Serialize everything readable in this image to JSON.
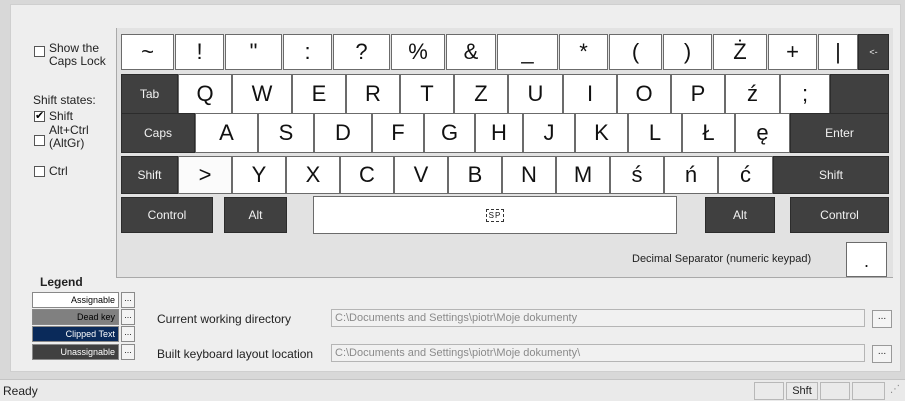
{
  "options": {
    "caps_lock_label": "Show the Caps Lock",
    "caps_lock_checked": false,
    "shift_states_title": "Shift states:",
    "shift_label": "Shift",
    "shift_checked": true,
    "altgr_label": "Alt+Ctrl (AltGr)",
    "altgr_checked": false,
    "ctrl_label": "Ctrl",
    "ctrl_checked": false
  },
  "keyboard": {
    "row1": [
      "~",
      "!",
      "\"",
      ":",
      "?",
      "%",
      "&",
      "_",
      "*",
      "(",
      ")",
      "Ż",
      "+",
      "|"
    ],
    "backspace": "<-",
    "tab": "Tab",
    "row2": [
      "Q",
      "W",
      "E",
      "R",
      "T",
      "Z",
      "U",
      "I",
      "O",
      "P",
      "ź",
      ";"
    ],
    "caps": "Caps",
    "row3": [
      "A",
      "S",
      "D",
      "F",
      "G",
      "H",
      "J",
      "K",
      "L",
      "Ł",
      "ę"
    ],
    "enter": "Enter",
    "lshift": "Shift",
    "row4": [
      ">",
      "Y",
      "X",
      "C",
      "V",
      "B",
      "N",
      "M",
      "ś",
      "ń",
      "ć"
    ],
    "rshift": "Shift",
    "lcontrol": "Control",
    "lalt": "Alt",
    "space": "SP",
    "ralt": "Alt",
    "rcontrol": "Control"
  },
  "decimal": {
    "label": "Decimal Separator (numeric keypad)",
    "value": "."
  },
  "legend": {
    "title": "Legend",
    "items": [
      {
        "label": "Assignable",
        "color": "#ffffff",
        "text_color": "#000000"
      },
      {
        "label": "Dead key",
        "color": "#808080",
        "text_color": "#000000"
      },
      {
        "label": "Clipped Text",
        "color": "#0a2a5a",
        "text_color": "#ffffff"
      },
      {
        "label": "Unassignable",
        "color": "#404040",
        "text_color": "#ffffff"
      }
    ],
    "button_label": "..."
  },
  "paths": {
    "working_dir_label": "Current working directory",
    "working_dir_value": "C:\\Documents and Settings\\piotr\\Moje dokumenty",
    "build_label": "Built keyboard layout location",
    "build_value": "C:\\Documents and Settings\\piotr\\Moje dokumenty\\",
    "browse_label": "..."
  },
  "status": {
    "text": "Ready",
    "shift_indicator": "Shft"
  }
}
